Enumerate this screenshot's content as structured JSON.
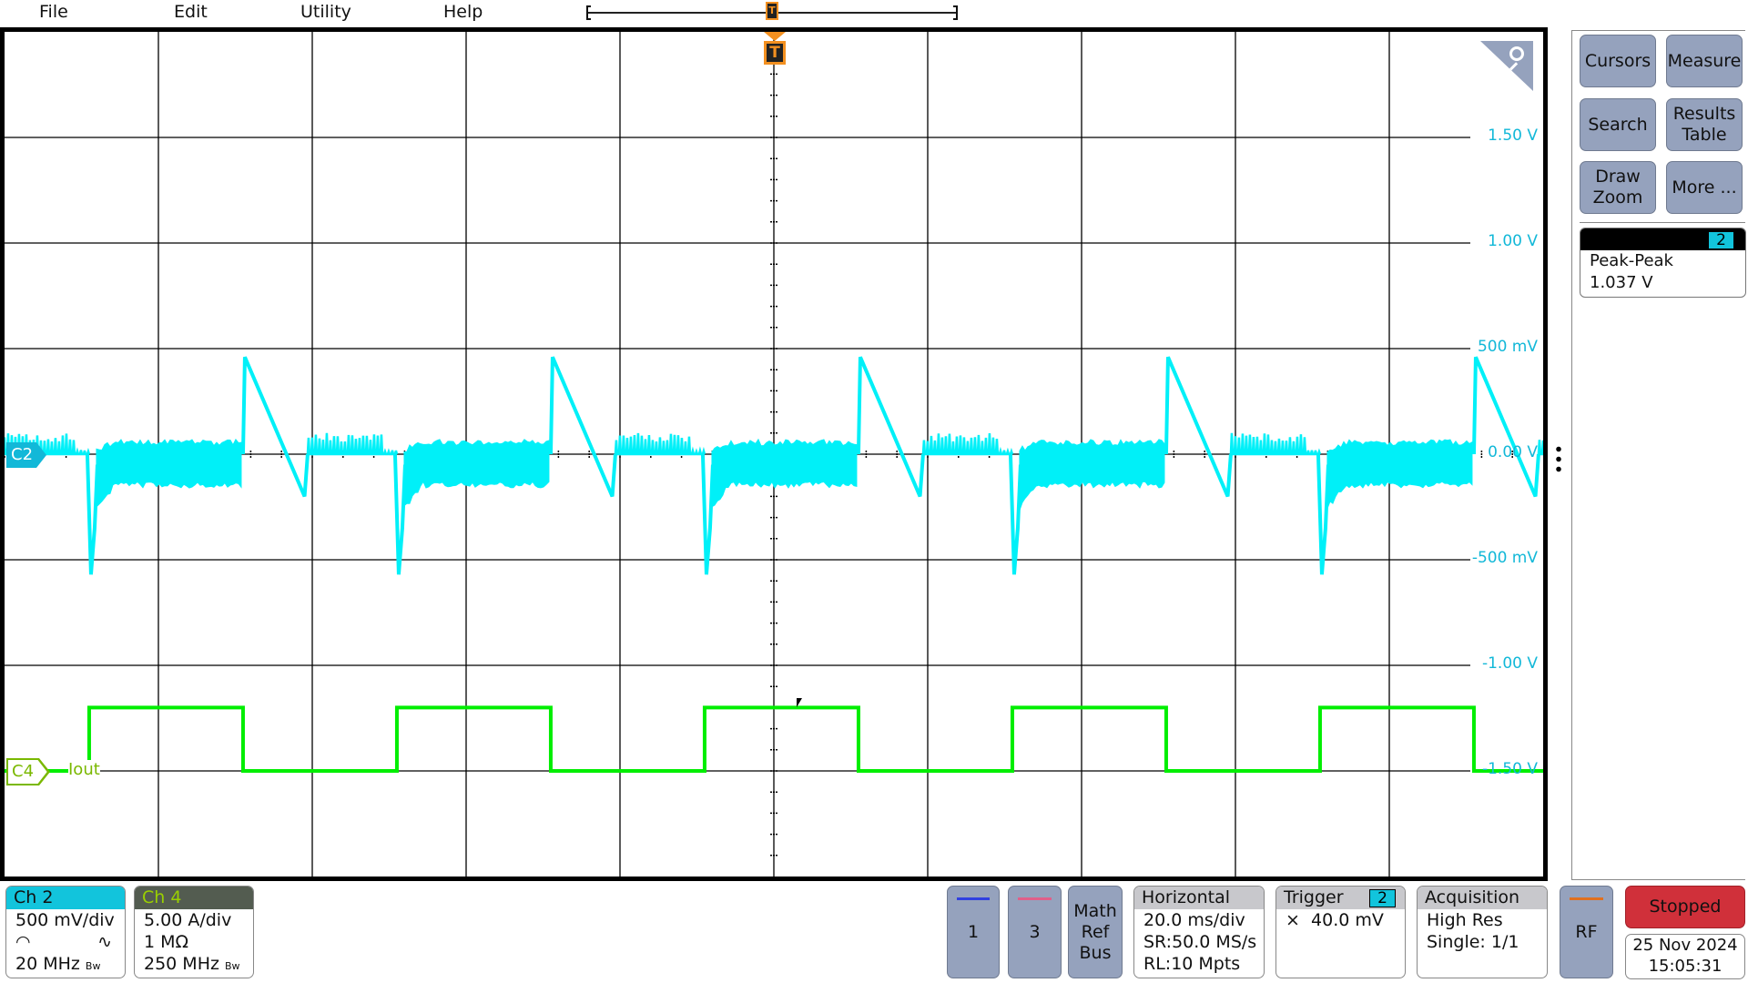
{
  "menu": {
    "file": "File",
    "edit": "Edit",
    "utility": "Utility",
    "help": "Help"
  },
  "trigger_marker": "T",
  "ch2_axis_labels": [
    "1.50 V",
    "1.00 V",
    "500 mV",
    "0.00 V",
    "-500 mV",
    "-1.00 V",
    "-1.50 V"
  ],
  "ch2_tag": "C2",
  "ch4_tag": "C4",
  "ch4_label": "Iout",
  "colors": {
    "ch2": "#00f0f8",
    "ch4": "#00ee00",
    "ch4_tag": "#7ab800",
    "trigger": "#f39020",
    "stopped": "#d0303a"
  },
  "waveform": {
    "timebase_ms_per_div": 20,
    "period_ms": 40,
    "ch4_high_A": 3,
    "ch4_low_A": 0,
    "ch2_peak_V": 0.46,
    "ch2_dip_V": -0.57
  },
  "side": {
    "cursors": "Cursors",
    "measure": "Measure",
    "search": "Search",
    "results_table": "Results Table",
    "draw_zoom": "Draw Zoom",
    "more": "More ..."
  },
  "measurement": {
    "source": "2",
    "name": "Peak-Peak",
    "value": "1.037 V"
  },
  "ch2": {
    "title": "Ch 2",
    "scale": "500 mV/div",
    "bandwidth": "20 MHz"
  },
  "ch4": {
    "title": "Ch 4",
    "scale": "5.00 A/div",
    "impedance": "1 MΩ",
    "bandwidth": "250 MHz"
  },
  "bw_mark": "Bw",
  "buttons": {
    "ch1": "1",
    "ch3": "3",
    "math": "Math Ref Bus",
    "rf": "RF"
  },
  "horizontal": {
    "title": "Horizontal",
    "scale": "20.0 ms/div",
    "sr": "SR:50.0 MS/s",
    "rl": "RL:10 Mpts"
  },
  "trigger": {
    "title": "Trigger",
    "source": "2",
    "level": "40.0 mV"
  },
  "acquisition": {
    "title": "Acquisition",
    "mode": "High Res",
    "count": "Single: 1/1"
  },
  "status": "Stopped",
  "date": "25 Nov 2024",
  "time": "15:05:31"
}
